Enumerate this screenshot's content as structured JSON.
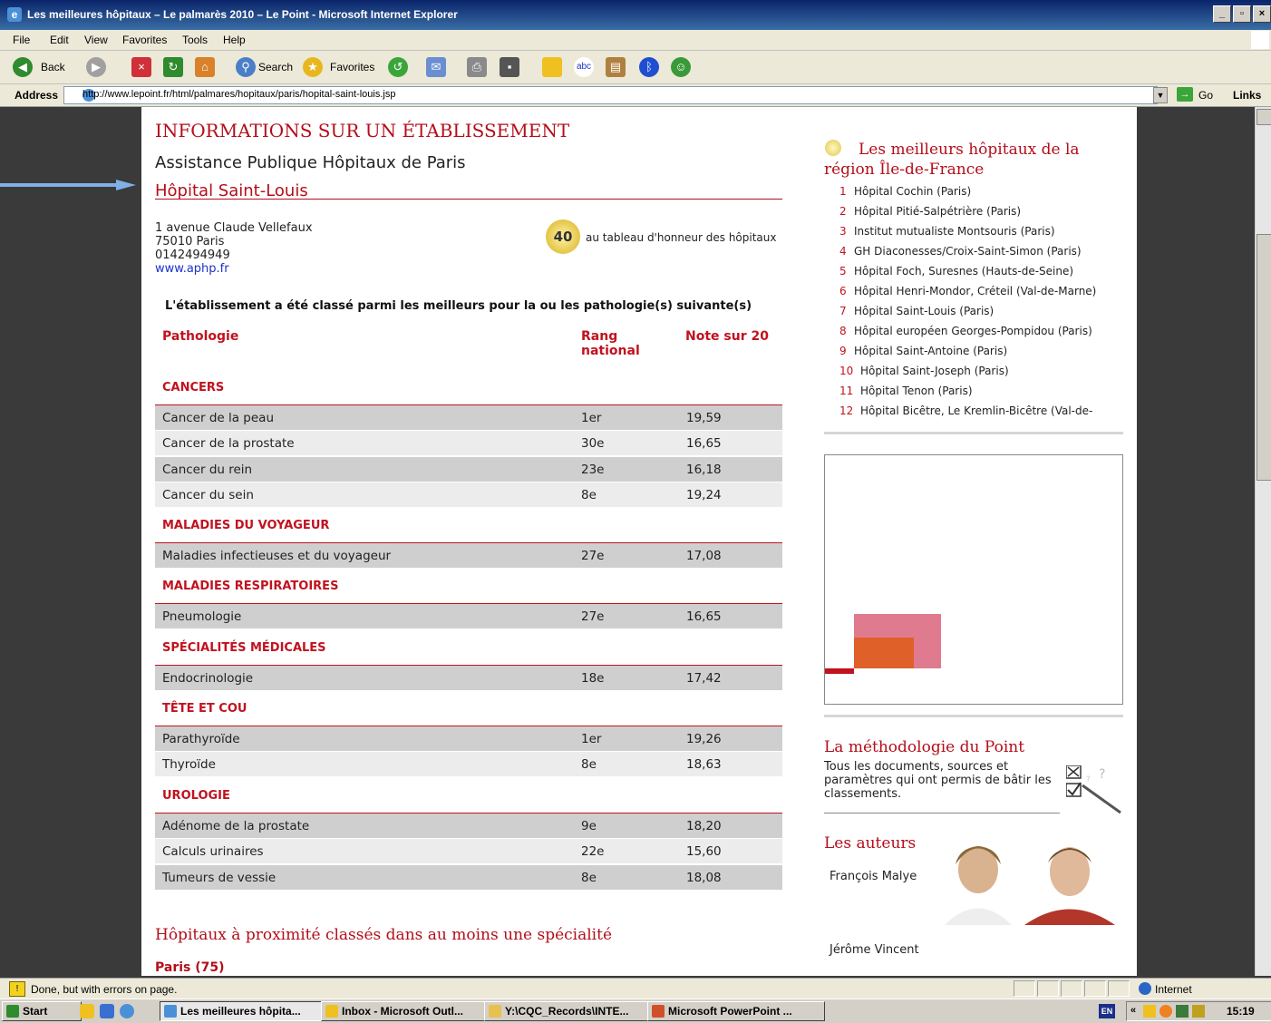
{
  "window": {
    "title": "Les meilleures hôpitaux – Le palmarès 2010 – Le Point - Microsoft Internet Explorer"
  },
  "menu": [
    "File",
    "Edit",
    "View",
    "Favorites",
    "Tools",
    "Help"
  ],
  "toolbar": {
    "back": "Back",
    "search": "Search",
    "favorites": "Favorites"
  },
  "address": {
    "label": "Address",
    "url": "http://www.lepoint.fr/html/palmares/hopitaux/paris/hopital-saint-louis.jsp",
    "go": "Go",
    "links": "Links"
  },
  "main": {
    "section_title": "INFORMATIONS SUR UN ÉTABLISSEMENT",
    "org": "Assistance Publique Hôpitaux de Paris",
    "hospital": "Hôpital Saint-Louis",
    "address_lines": [
      "1 avenue Claude Vellefaux",
      "75010 Paris",
      "0142494949"
    ],
    "website": "www.aphp.fr",
    "badge_number": "40",
    "badge_text": "au tableau d'honneur des hôpitaux",
    "intro": "L'établissement a été classé parmi les meilleurs pour la ou les pathologie(s) suivante(s)",
    "headers": {
      "pathologie": "Pathologie",
      "rang_1": "Rang",
      "rang_2": "national",
      "note": "Note sur 20"
    },
    "groups": [
      {
        "name": "CANCERS",
        "rows": [
          {
            "path": "Cancer de la peau",
            "rang": "1er",
            "note": "19,59"
          },
          {
            "path": "Cancer de la prostate",
            "rang": "30e",
            "note": "16,65"
          },
          {
            "path": "Cancer du rein",
            "rang": "23e",
            "note": "16,18"
          },
          {
            "path": "Cancer du sein",
            "rang": "8e",
            "note": "19,24"
          }
        ]
      },
      {
        "name": "MALADIES DU VOYAGEUR",
        "rows": [
          {
            "path": "Maladies infectieuses et du voyageur",
            "rang": "27e",
            "note": "17,08"
          }
        ]
      },
      {
        "name": "MALADIES RESPIRATOIRES",
        "rows": [
          {
            "path": "Pneumologie",
            "rang": "27e",
            "note": "16,65"
          }
        ]
      },
      {
        "name": "SPÉCIALITÉS MÉDICALES",
        "rows": [
          {
            "path": "Endocrinologie",
            "rang": "18e",
            "note": "17,42"
          }
        ]
      },
      {
        "name": "TÊTE ET COU",
        "rows": [
          {
            "path": "Parathyroïde",
            "rang": "1er",
            "note": "19,26"
          },
          {
            "path": "Thyroïde",
            "rang": "8e",
            "note": "18,63"
          }
        ]
      },
      {
        "name": "UROLOGIE",
        "rows": [
          {
            "path": "Adénome de la prostate",
            "rang": "9e",
            "note": "18,20"
          },
          {
            "path": "Calculs urinaires",
            "rang": "22e",
            "note": "15,60"
          },
          {
            "path": "Tumeurs de vessie",
            "rang": "8e",
            "note": "18,08"
          }
        ]
      }
    ],
    "nearby_title": "Hôpitaux à proximité classés dans au moins une spécialité",
    "nearby_sub": "Paris (75)"
  },
  "sidebar": {
    "title": "Les meilleurs hôpitaux de la région Île-de-France",
    "ranking": [
      {
        "n": "1",
        "name": "Hôpital Cochin (Paris)"
      },
      {
        "n": "2",
        "name": "Hôpital Pitié-Salpétrière (Paris)"
      },
      {
        "n": "3",
        "name": "Institut mutualiste Montsouris (Paris)"
      },
      {
        "n": "4",
        "name": "GH Diaconesses/Croix-Saint-Simon (Paris)"
      },
      {
        "n": "5",
        "name": "Hôpital Foch, Suresnes (Hauts-de-Seine)"
      },
      {
        "n": "6",
        "name": "Hôpital Henri-Mondor, Créteil (Val-de-Marne)"
      },
      {
        "n": "7",
        "name": "Hôpital Saint-Louis (Paris)"
      },
      {
        "n": "8",
        "name": "Hôpital européen Georges-Pompidou (Paris)"
      },
      {
        "n": "9",
        "name": "Hôpital Saint-Antoine (Paris)"
      },
      {
        "n": "10",
        "name": "Hôpital Saint-Joseph (Paris)"
      },
      {
        "n": "11",
        "name": "Hôpital Tenon (Paris)"
      },
      {
        "n": "12",
        "name": "Hôpital Bicêtre, Le Kremlin-Bicêtre (Val-de-"
      }
    ],
    "method_title": "La méthodologie du Point",
    "method_text": "Tous les documents, sources et paramètres qui ont permis de bâtir les classements.",
    "authors_title": "Les auteurs",
    "author1": "François Malye",
    "author2": "Jérôme Vincent"
  },
  "status": {
    "text": "Done, but with errors on page.",
    "zone": "Internet"
  },
  "taskbar": {
    "start": "Start",
    "tasks": [
      "Les meilleures hôpita...",
      "Inbox - Microsoft Outl...",
      "Y:\\CQC_Records\\INTE...",
      "Microsoft PowerPoint ..."
    ],
    "lang": "EN",
    "clock": "15:19"
  },
  "colors": {
    "accent": "#c1121f",
    "titlebar": "#0a246a",
    "panel": "#ffffff",
    "backdrop": "#3a3a3a"
  }
}
